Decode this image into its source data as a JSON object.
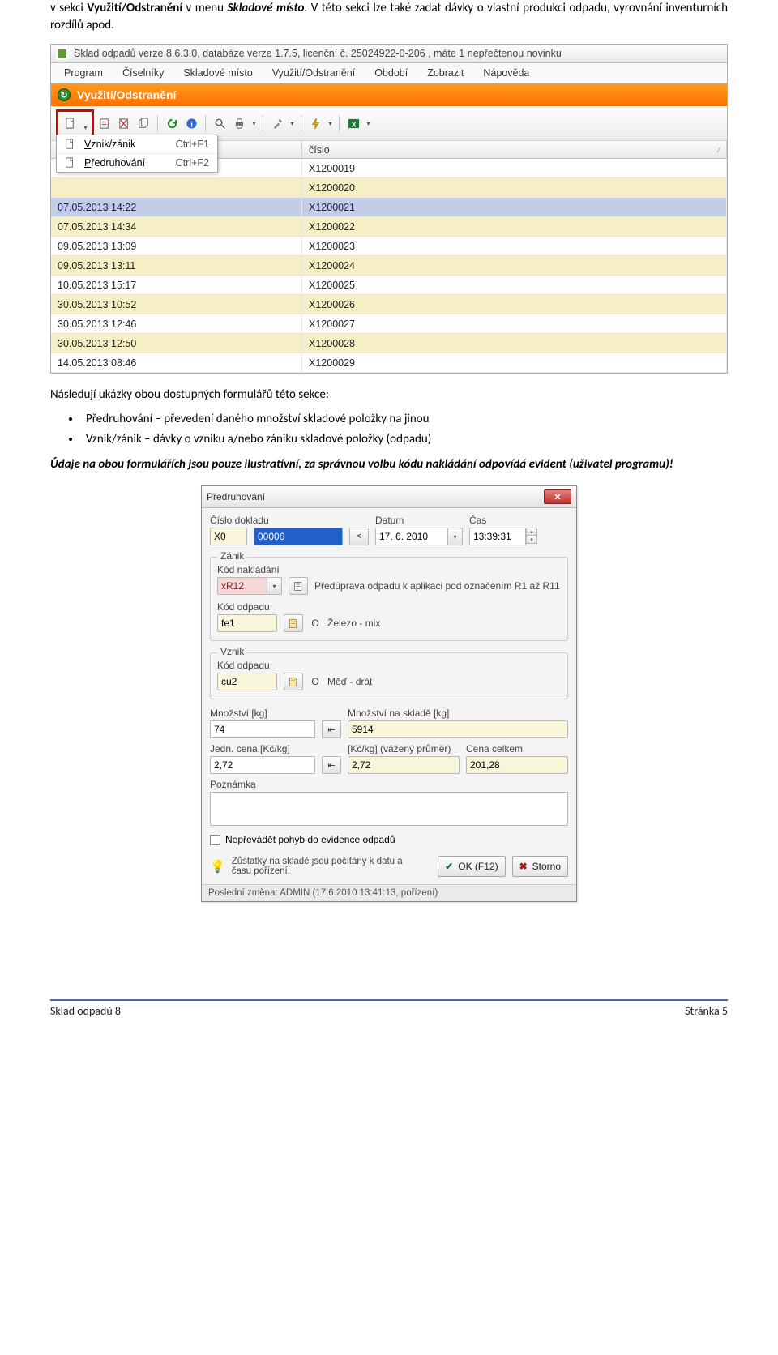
{
  "intro": {
    "p1a": "v sekci ",
    "p1b": "Využití/Odstranění",
    "p1c": " v menu ",
    "p1d": "Skladové místo",
    "p1e": ". V této sekci lze také zadat dávky o vlastní produkci odpadu, vyrovnání inventurních rozdílů apod."
  },
  "app": {
    "title": "Sklad odpadů verze 8.6.3.0, databáze verze 1.7.5, licenční č. 25024922-0-206 , máte 1 nepřečtenou novinku",
    "menus": [
      "Program",
      "Číselníky",
      "Skladové místo",
      "Využití/Odstranění",
      "Období",
      "Zobrazit",
      "Nápověda"
    ],
    "section": "Využití/Odstranění",
    "dropdown": [
      {
        "icon": "doc",
        "label": "Vznik/zánik",
        "shortcut": "Ctrl+F1",
        "underlineIdx": 0
      },
      {
        "icon": "doc",
        "label": "Předruhování",
        "shortcut": "Ctrl+F2",
        "underlineIdx": 0
      }
    ],
    "col2_header": "číslo",
    "rows": [
      {
        "date": "",
        "num": "X1200019",
        "alt": false,
        "hidden": true
      },
      {
        "date": "",
        "num": "X1200020",
        "alt": true,
        "hidden": true
      },
      {
        "date": "07.05.2013 14:22",
        "num": "X1200021",
        "alt": false,
        "sel": true
      },
      {
        "date": "07.05.2013 14:34",
        "num": "X1200022",
        "alt": true
      },
      {
        "date": "09.05.2013 13:09",
        "num": "X1200023",
        "alt": false
      },
      {
        "date": "09.05.2013 13:11",
        "num": "X1200024",
        "alt": true
      },
      {
        "date": "10.05.2013 15:17",
        "num": "X1200025",
        "alt": false
      },
      {
        "date": "30.05.2013 10:52",
        "num": "X1200026",
        "alt": true
      },
      {
        "date": "30.05.2013 12:46",
        "num": "X1200027",
        "alt": false
      },
      {
        "date": "30.05.2013 12:50",
        "num": "X1200028",
        "alt": true
      },
      {
        "date": "14.05.2013 08:46",
        "num": "X1200029",
        "alt": false
      }
    ]
  },
  "mid": {
    "lead": "Následují ukázky obou dostupných formulářů této sekce:",
    "bullets": [
      "Předruhování – převedení daného množství skladové položky na jinou",
      "Vznik/zánik – dávky o vzniku a/nebo zániku skladové položky (odpadu)"
    ],
    "note": "Údaje na obou formulářích jsou pouze ilustrativní, za správnou volbu kódu nakládání odpovídá evident (uživatel programu)!"
  },
  "dlg": {
    "title": "Předruhování",
    "labels": {
      "cislo": "Číslo dokladu",
      "datum": "Datum",
      "cas": "Čas",
      "zanik": "Zánik",
      "kodnak": "Kód nakládání",
      "kododp": "Kód odpadu",
      "vznik": "Vznik",
      "mnoz": "Množství [kg]",
      "mnozsklad": "Množství na skladě [kg]",
      "jedn": "Jedn. cena [Kč/kg]",
      "prum": "[Kč/kg] (vážený průměr)",
      "cena": "Cena celkem",
      "pozn": "Poznámka",
      "neprev": "Nepřevádět pohyb do evidence odpadů",
      "hint": "Zůstatky na skladě jsou počítány k datu a času pořízení.",
      "ok": "OK (F12)",
      "storno": "Storno"
    },
    "vals": {
      "cislo_prefix": "X0",
      "cislo_num": "00006",
      "datum": "17.  6. 2010",
      "cas": "13:39:31",
      "zanik_kodnak": "xR12",
      "zanik_kodnak_desc": "Předúprava odpadu k aplikaci pod označením R1 až R11",
      "zanik_kododp": "fe1",
      "zanik_kododp_o": "O",
      "zanik_kododp_desc": "Železo - mix",
      "vznik_kododp": "cu2",
      "vznik_kododp_o": "O",
      "vznik_kododp_desc": "Měď - drát",
      "mnoz": "74",
      "mnozsklad": "5914",
      "jedn": "2,72",
      "prum": "2,72",
      "cena": "201,28",
      "pozn": ""
    },
    "status": "Poslední změna: ADMIN (17.6.2010 13:41:13, pořízení)"
  },
  "footer": {
    "left": "Sklad odpadů 8",
    "right": "Stránka 5"
  }
}
